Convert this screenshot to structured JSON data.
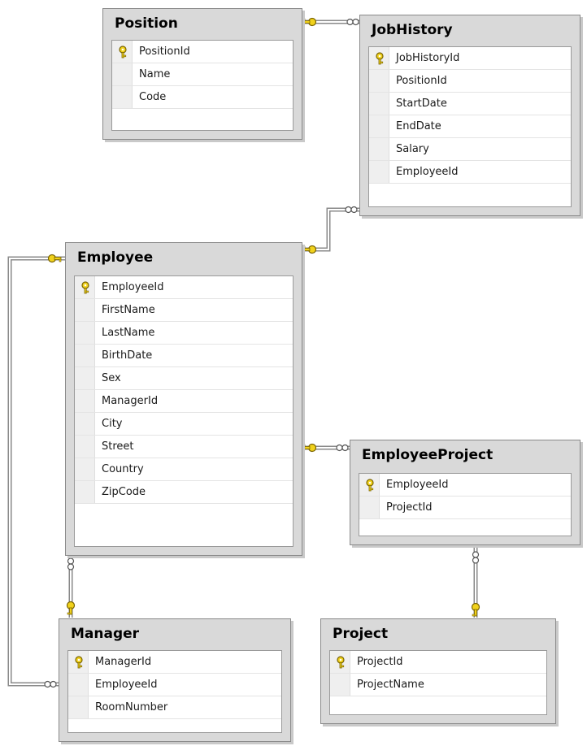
{
  "tables": {
    "position": {
      "title": "Position",
      "columns": [
        "PositionId",
        "Name",
        "Code"
      ]
    },
    "jobhistory": {
      "title": "JobHistory",
      "columns": [
        "JobHistoryId",
        "PositionId",
        "StartDate",
        "EndDate",
        "Salary",
        "EmployeeId"
      ]
    },
    "employee": {
      "title": "Employee",
      "columns": [
        "EmployeeId",
        "FirstName",
        "LastName",
        "BirthDate",
        "Sex",
        "ManagerId",
        "City",
        "Street",
        "Country",
        "ZipCode"
      ]
    },
    "employeeproject": {
      "title": "EmployeeProject",
      "columns": [
        "EmployeeId",
        "ProjectId"
      ]
    },
    "manager": {
      "title": "Manager",
      "columns": [
        "ManagerId",
        "EmployeeId",
        "RoomNumber"
      ]
    },
    "project": {
      "title": "Project",
      "columns": [
        "ProjectId",
        "ProjectName"
      ]
    }
  },
  "colors": {
    "key": "#f1d21c",
    "key_outline": "#7a6400",
    "line": "#7a7a7a"
  }
}
